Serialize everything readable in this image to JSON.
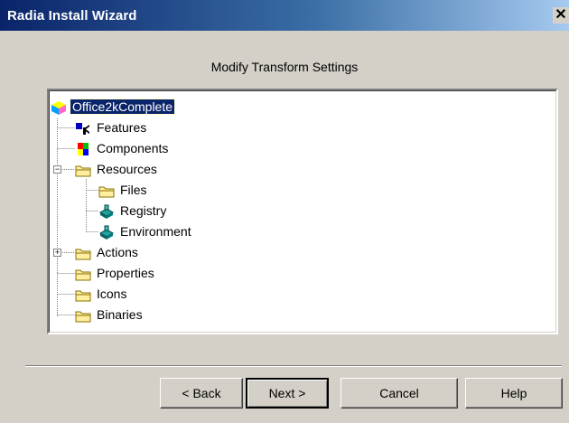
{
  "window": {
    "title": "Radia Install Wizard",
    "close_glyph": "✕"
  },
  "heading": "Modify Transform Settings",
  "tree": {
    "root": {
      "label": "Office2kComplete",
      "icon": "package-icon",
      "selected": true
    },
    "items": [
      {
        "label": "Features",
        "icon": "features-icon"
      },
      {
        "label": "Components",
        "icon": "components-icon"
      },
      {
        "label": "Resources",
        "icon": "folder-icon",
        "expander": "−"
      },
      {
        "label": "Files",
        "icon": "folder-icon"
      },
      {
        "label": "Registry",
        "icon": "registry-icon"
      },
      {
        "label": "Environment",
        "icon": "registry-icon"
      },
      {
        "label": "Actions",
        "icon": "folder-icon",
        "expander": "+"
      },
      {
        "label": "Properties",
        "icon": "folder-icon"
      },
      {
        "label": "Icons",
        "icon": "folder-icon"
      },
      {
        "label": "Binaries",
        "icon": "folder-icon"
      }
    ]
  },
  "buttons": {
    "back": "< Back",
    "next": "Next >",
    "cancel": "Cancel",
    "help": "Help"
  }
}
